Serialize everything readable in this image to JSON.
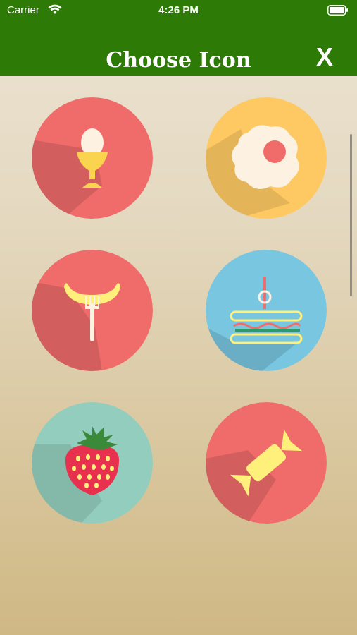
{
  "status_bar": {
    "carrier": "Carrier",
    "time": "4:26 PM"
  },
  "header": {
    "title": "Choose Icon",
    "close_label": "X"
  },
  "icons": [
    {
      "name": "egg-cup-icon",
      "color": "#f06c6b"
    },
    {
      "name": "fried-egg-icon",
      "color": "#fec963"
    },
    {
      "name": "sausage-fork-icon",
      "color": "#f06c6b"
    },
    {
      "name": "sandwich-icon",
      "color": "#78c6e0"
    },
    {
      "name": "strawberry-icon",
      "color": "#93cdbd"
    },
    {
      "name": "candy-icon",
      "color": "#f06c6b"
    }
  ],
  "colors": {
    "header_bg": "#2e7a07",
    "accent_red": "#f06c6b",
    "accent_yellow": "#fec963"
  }
}
